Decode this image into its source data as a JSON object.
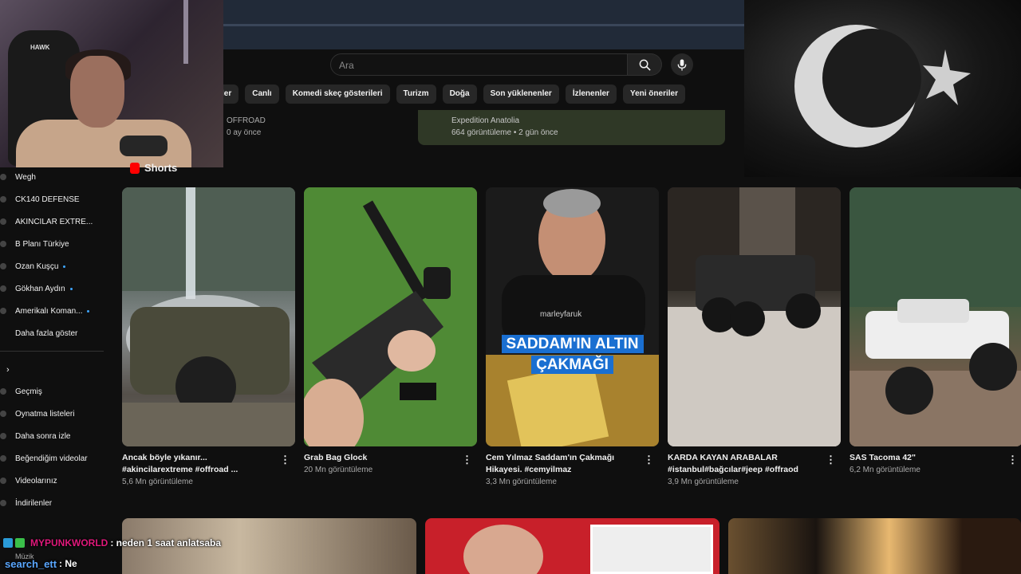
{
  "search": {
    "placeholder": "Ara"
  },
  "chips": [
    "ler",
    "Canlı",
    "Komedi skeç gösterileri",
    "Turizm",
    "Doğa",
    "Son yüklenenler",
    "İzlenenler",
    "Yeni öneriler"
  ],
  "prev_row": {
    "left_channel": "OFFROAD",
    "left_meta": "0 ay önce",
    "card_channel": "Expedition Anatolia",
    "card_meta": "664 görüntüleme • 2 gün önce"
  },
  "shorts_header": "Shorts",
  "sidebar": {
    "subscriptions": [
      {
        "label": "Wegh",
        "new": false
      },
      {
        "label": "CK140 DEFENSE",
        "new": false
      },
      {
        "label": "AKINCILAR EXTRE...",
        "new": false
      },
      {
        "label": "B Planı Türkiye",
        "new": false
      },
      {
        "label": "Ozan Kuşçu",
        "new": true
      },
      {
        "label": "Gökhan Aydın",
        "new": true
      },
      {
        "label": "Amerikalı Koman...",
        "new": true
      }
    ],
    "show_more": "Daha fazla göster",
    "you": [
      "Geçmiş",
      "Oynatma listeleri",
      "Daha sonra izle",
      "Beğendiğim videolar",
      "Videolarınız",
      "İndirilenler"
    ],
    "music": "Müzik"
  },
  "shorts": [
    {
      "title": "Ancak böyle yıkanır... #akincilarextreme #offroad ...",
      "views": "5,6 Mn görüntüleme"
    },
    {
      "title": "Grab Bag Glock",
      "views": "20 Mn görüntüleme"
    },
    {
      "title": "Cem Yılmaz Saddam'ın Çakmağı Hikayesi. #cemyilmaz",
      "views": "3,3 Mn görüntüleme",
      "overlay_line1": "SADDAM'IN ALTIN",
      "overlay_line2": "ÇAKMAĞI",
      "watermark": "marleyfaruk"
    },
    {
      "title": "KARDA KAYAN ARABALAR #istanbul#bağcılar#jeep #offraod",
      "views": "3,9 Mn görüntüleme"
    },
    {
      "title": "SAS Tacoma 42\"",
      "views": "6,2 Mn görüntüleme"
    }
  ],
  "chat": [
    {
      "user": "MYPUNKWORLD",
      "message": ": neden 1 saat anlatsaba"
    },
    {
      "user": "search_ett",
      "message": ": Ne"
    }
  ],
  "colors": {
    "chat_user1": "#e0197b",
    "chat_user2": "#5aa7ff",
    "shorts_red": "#ff0000",
    "new_dot": "#3ea6ff"
  }
}
